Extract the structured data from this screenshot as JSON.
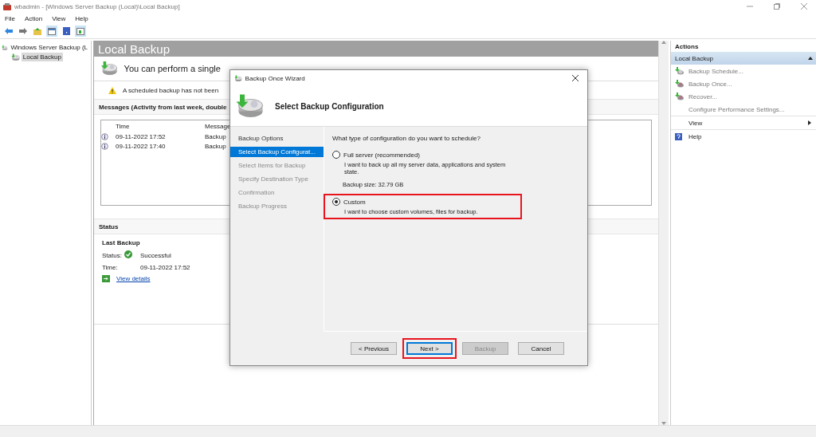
{
  "window": {
    "title": "wbadmin - [Windows Server Backup (Local)\\Local Backup]"
  },
  "menu": [
    "File",
    "Action",
    "View",
    "Help"
  ],
  "tree": [
    {
      "label": "Windows Server Backup (L",
      "selected": false,
      "children": [
        {
          "label": "Local Backup",
          "selected": true
        }
      ]
    }
  ],
  "center": {
    "title": "Local Backup",
    "intro": "You can perform a single",
    "warning": "A scheduled backup has not been",
    "messages": {
      "header": "Messages (Activity from last week, double",
      "columns": [
        "Time",
        "Message"
      ],
      "rows": [
        {
          "time": "09-11-2022 17:52",
          "message": "Backup"
        },
        {
          "time": "09-11-2022 17:40",
          "message": "Backup"
        }
      ]
    },
    "status": {
      "header": "Status",
      "section_title": "Last Backup",
      "fields": [
        {
          "label": "Status:",
          "value": "Successful",
          "kind": "success"
        },
        {
          "label": "Time:",
          "value": "09-11-2022 17:52",
          "kind": "plain"
        }
      ],
      "link": "View details"
    }
  },
  "actions": {
    "header": "Actions",
    "group": {
      "label": "Local Backup",
      "expanded": true
    },
    "items": [
      {
        "label": "Backup Schedule...",
        "kind": "schedule",
        "disabled": true
      },
      {
        "label": "Backup Once...",
        "kind": "once",
        "disabled": true
      },
      {
        "label": "Recover...",
        "kind": "recover",
        "disabled": true
      },
      {
        "label": "Configure Performance Settings...",
        "kind": "plain",
        "disabled": true
      },
      {
        "label": "View",
        "kind": "submenu",
        "disabled": false
      },
      {
        "label": "Help",
        "kind": "help",
        "disabled": false
      }
    ]
  },
  "dialog": {
    "title": "Backup Once Wizard",
    "heading": "Select Backup Configuration",
    "steps": [
      {
        "label": "Backup Options",
        "selected": false,
        "disabled": false
      },
      {
        "label": "Select Backup Configurat...",
        "selected": true,
        "disabled": false
      },
      {
        "label": "Select Items for Backup",
        "selected": false,
        "disabled": true
      },
      {
        "label": "Specify Destination Type",
        "selected": false,
        "disabled": true
      },
      {
        "label": "Confirmation",
        "selected": false,
        "disabled": true
      },
      {
        "label": "Backup Progress",
        "selected": false,
        "disabled": true
      }
    ],
    "question": "What type of configuration do you want to schedule?",
    "options": [
      {
        "label": "Full server (recommended)",
        "description": "I want to back up all my server data, applications and system state.",
        "note": "Backup size: 32.79 GB",
        "selected": false,
        "highlighted": false
      },
      {
        "label": "Custom",
        "description": "I want to choose custom volumes, files for backup.",
        "selected": true,
        "highlighted": true
      }
    ],
    "buttons": [
      {
        "label": "< Previous",
        "disabled": false,
        "default": false,
        "highlighted": false
      },
      {
        "label": "Next >",
        "disabled": false,
        "default": true,
        "highlighted": true
      },
      {
        "label": "Backup",
        "disabled": true,
        "default": false,
        "highlighted": false
      },
      {
        "label": "Cancel",
        "disabled": false,
        "default": false,
        "highlighted": false
      }
    ]
  }
}
